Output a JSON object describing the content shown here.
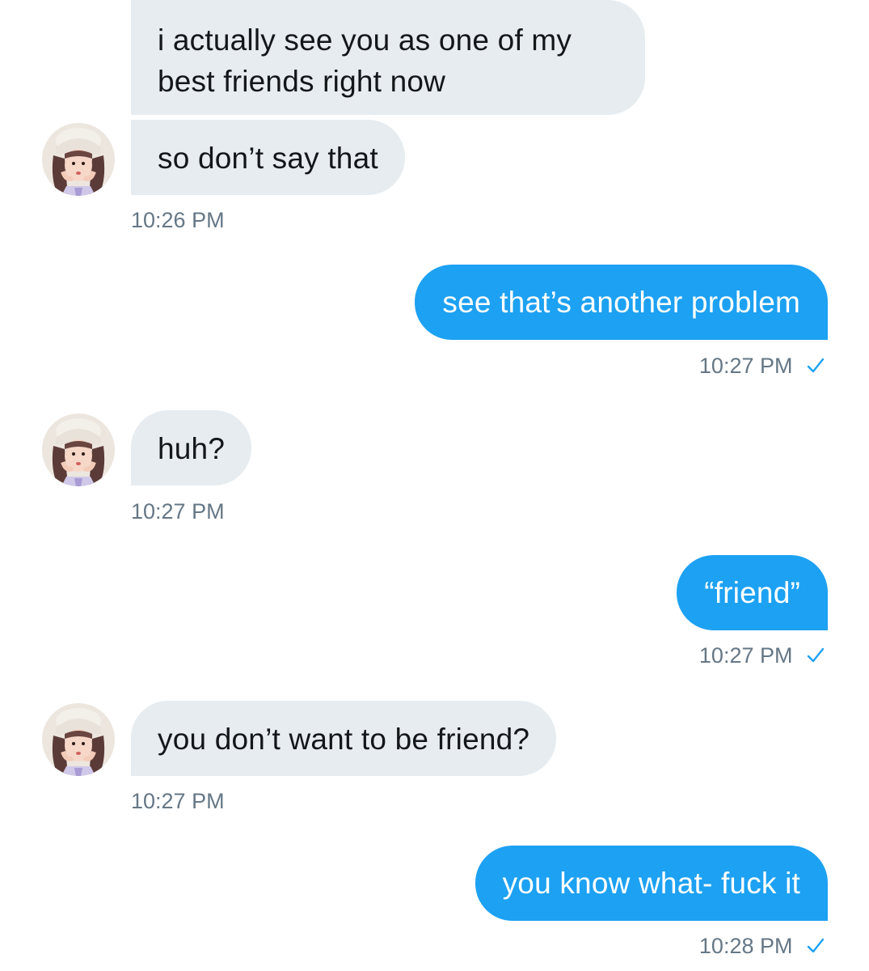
{
  "messages": [
    {
      "direction": "incoming",
      "text_lines": [
        "i actually see you as one of my",
        "best friends right now"
      ]
    },
    {
      "direction": "incoming",
      "text": "so don’t say that",
      "time": "10:26 PM"
    },
    {
      "direction": "outgoing",
      "text": "see that’s another problem",
      "time": "10:27 PM",
      "status_icon": "checkmark-icon"
    },
    {
      "direction": "incoming",
      "text": "huh?",
      "time": "10:27 PM"
    },
    {
      "direction": "outgoing",
      "text": "“friend”",
      "time": "10:27 PM",
      "status_icon": "checkmark-icon"
    },
    {
      "direction": "incoming",
      "text": "you don’t want to be friend?",
      "time": "10:27 PM"
    },
    {
      "direction": "outgoing",
      "text": "you know what- fuck it",
      "time": "10:28 PM",
      "status_icon": "checkmark-icon"
    }
  ],
  "colors": {
    "incoming_bubble": "#e6ecf0",
    "outgoing_bubble": "#1da1f2",
    "timestamp": "#657786",
    "check": "#1da1f2"
  }
}
